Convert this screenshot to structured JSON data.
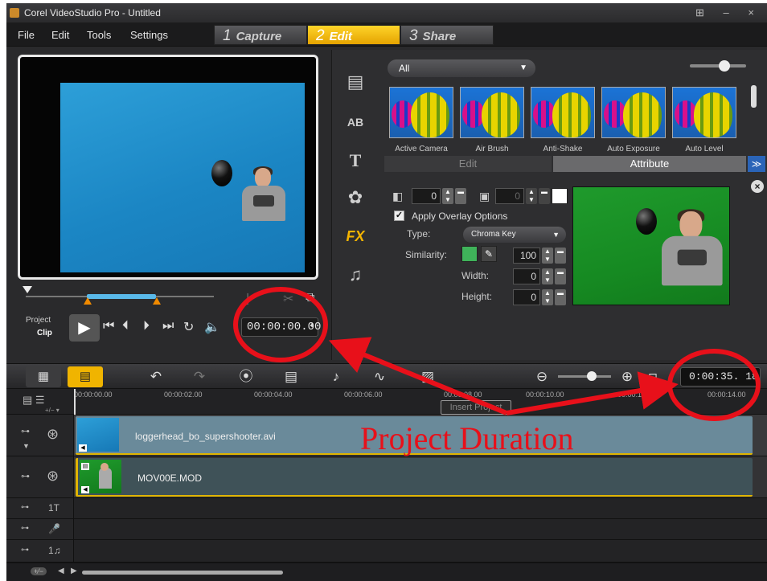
{
  "window": {
    "title": "Corel VideoStudio Pro - Untitled",
    "controls": "⊞ – ×"
  },
  "menu": [
    "File",
    "Edit",
    "Tools",
    "Settings"
  ],
  "steps": [
    {
      "num": "1",
      "label": "Capture"
    },
    {
      "num": "2",
      "label": "Edit"
    },
    {
      "num": "3",
      "label": "Share"
    }
  ],
  "preview": {
    "mode_project": "Project",
    "mode_clip": "Clip",
    "timecode": "00:00:00.00"
  },
  "library": {
    "filter_selected": "All",
    "filters": [
      "Active Camera",
      "Air Brush",
      "Anti-Shake",
      "Auto Exposure",
      "Auto Level"
    ],
    "tabs": {
      "edit": "Edit",
      "attribute": "Attribute"
    }
  },
  "attribute": {
    "mask_value": "0",
    "border_value": "0",
    "overlay_label": "Apply Overlay Options",
    "type_label": "Type:",
    "type_value": "Chroma Key",
    "similarity_label": "Similarity:",
    "similarity_value": "100",
    "width_label": "Width:",
    "width_value": "0",
    "height_label": "Height:",
    "height_value": "0"
  },
  "timeline": {
    "project_duration": "0:00:35. 18",
    "insert_tooltip": "Insert Project",
    "ruler": [
      "00:00:00.00",
      "00:00:02.00",
      "00:00:04.00",
      "00:00:06.00",
      "00:00:08.00",
      "00:00:10.00",
      "00:00:12.00",
      "00:00:14.00"
    ],
    "clips": {
      "video": "loggerhead_bo_supershooter.avi",
      "overlay": "MOV00E.MOD"
    }
  },
  "annotation": {
    "text": "Project Duration",
    "color": "#e8101a"
  },
  "colors": {
    "accent": "#f0b400",
    "overlay_border": "#e0b400",
    "video_clip": "#6a8a9a",
    "overlay_clip": "#3f5258"
  }
}
